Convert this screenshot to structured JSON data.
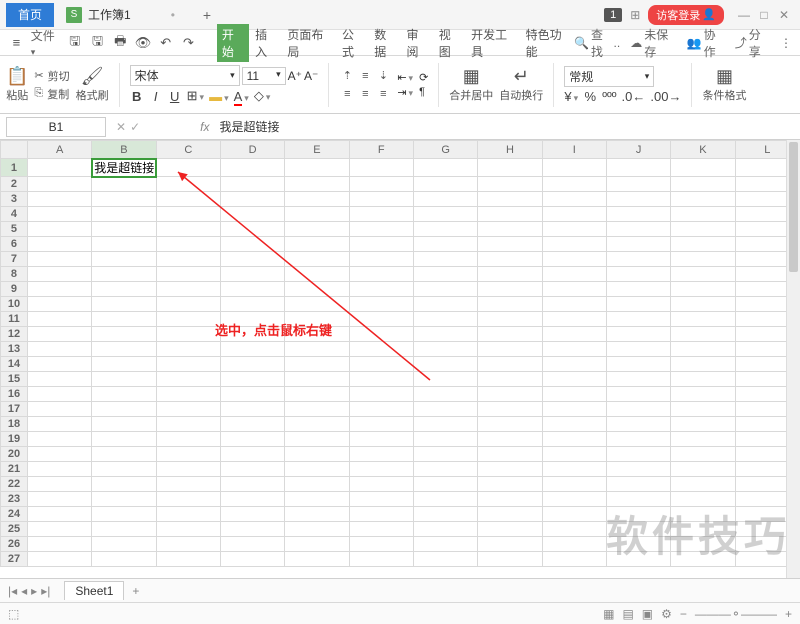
{
  "titlebar": {
    "home": "首页",
    "docname": "工作簿1",
    "badge": "1",
    "login": "访客登录"
  },
  "quick": {
    "file": "文件",
    "menu": [
      "开始",
      "插入",
      "页面布局",
      "公式",
      "数据",
      "审阅",
      "视图",
      "开发工具",
      "特色功能"
    ],
    "search": "查找",
    "unsaved": "未保存",
    "coop": "协作",
    "share": "分享"
  },
  "ribbon": {
    "cut": "剪切",
    "copy": "复制",
    "paste": "粘贴",
    "fmt": "格式刷",
    "font": "宋体",
    "size": "11",
    "merge": "合并居中",
    "wrap": "自动换行",
    "numfmt": "常规",
    "condfmt": "条件格式"
  },
  "namebox": "B1",
  "formula": "我是超链接",
  "cols": [
    "A",
    "B",
    "C",
    "D",
    "E",
    "F",
    "G",
    "H",
    "I",
    "J",
    "K",
    "L"
  ],
  "rows": [
    "1",
    "2",
    "3",
    "4",
    "5",
    "6",
    "7",
    "8",
    "9",
    "10",
    "11",
    "12",
    "13",
    "14",
    "15",
    "16",
    "17",
    "18",
    "19",
    "20",
    "21",
    "22",
    "23",
    "24",
    "25",
    "26",
    "27"
  ],
  "cell_b1": "我是超链接",
  "annot": "选中，点击鼠标右键",
  "watermark": "软件技巧",
  "sheet": "Sheet1",
  "chart_data": null
}
